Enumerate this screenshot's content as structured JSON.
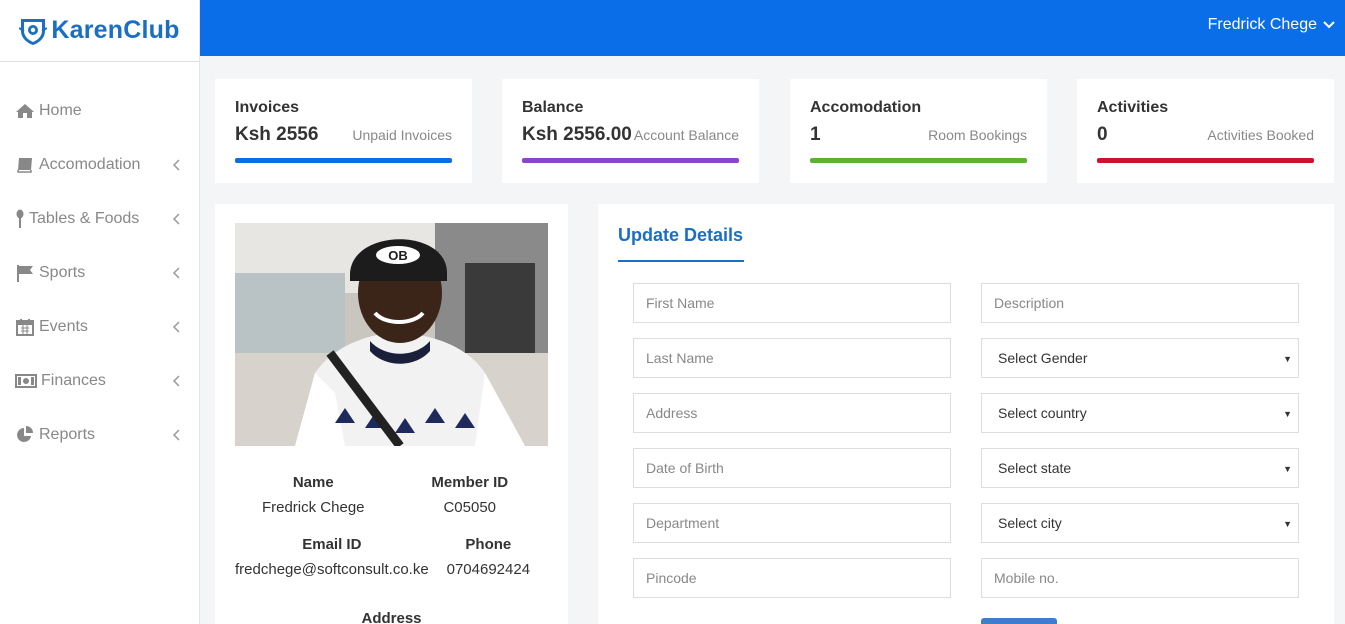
{
  "brand": {
    "name": "KarenClub"
  },
  "sidebar": {
    "items": [
      {
        "label": "Home",
        "icon": "home-icon"
      },
      {
        "label": "Accomodation",
        "icon": "book-icon"
      },
      {
        "label": "Tables & Foods",
        "icon": "spoon-icon"
      },
      {
        "label": "Sports",
        "icon": "flag-icon"
      },
      {
        "label": "Events",
        "icon": "calendar-icon"
      },
      {
        "label": "Finances",
        "icon": "money-icon"
      },
      {
        "label": "Reports",
        "icon": "pie-chart-icon"
      }
    ]
  },
  "header": {
    "user_name": "Fredrick Chege"
  },
  "stats": [
    {
      "title": "Invoices",
      "value": "Ksh 2556",
      "label": "Unpaid Invoices",
      "color": "#0a6ee8"
    },
    {
      "title": "Balance",
      "value": "Ksh 2556.00",
      "label": "Account Balance",
      "color": "#8e44c9"
    },
    {
      "title": "Accomodation",
      "value": "1",
      "label": "Room Bookings",
      "color": "#5fb135"
    },
    {
      "title": "Activities",
      "value": "0",
      "label": "Activities Booked",
      "color": "#d0112b"
    }
  ],
  "profile": {
    "name_label": "Name",
    "name": "Fredrick Chege",
    "member_id_label": "Member ID",
    "member_id": "C05050",
    "email_label": "Email ID",
    "email": "fredchege@softconsult.co.ke",
    "phone_label": "Phone",
    "phone": "0704692424",
    "address_label": "Address"
  },
  "update_form": {
    "tab_label": "Update Details",
    "first_name": {
      "placeholder": "First Name"
    },
    "last_name": {
      "placeholder": "Last Name"
    },
    "address": {
      "placeholder": "Address"
    },
    "dob": {
      "placeholder": "Date of Birth"
    },
    "department": {
      "placeholder": "Department"
    },
    "pincode": {
      "placeholder": "Pincode"
    },
    "description": {
      "placeholder": "Description"
    },
    "gender": {
      "selected": "Select Gender"
    },
    "country": {
      "selected": "Select country"
    },
    "state": {
      "selected": "Select state"
    },
    "city": {
      "selected": "Select city"
    },
    "mobile": {
      "placeholder": "Mobile no."
    }
  }
}
